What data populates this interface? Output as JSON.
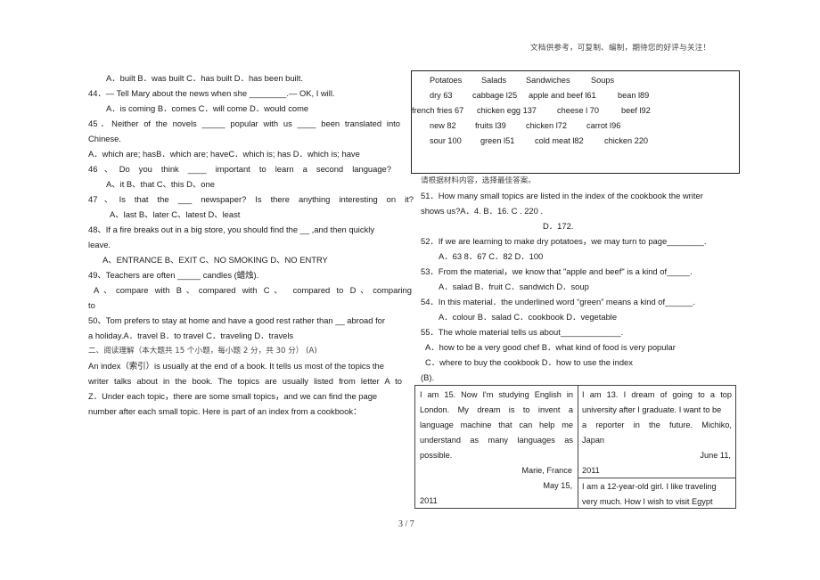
{
  "watermark": "文档供参考，可复制、编制，期待您的好评与关注！",
  "left": {
    "lines": [
      "A．built    B．was built  C．has built          D．has been built.",
      "44．— Tell Mary about the news when she ________.— OK, I will.",
      "A．is coming   B．comes  C．will come                D．would come",
      "45．Neither of the novels _____ popular with us ____ been translated into",
      "Chinese.",
      "A．which are; hasB．which are; haveC．which is; has D．which is; have",
      "46、Do you think ____ important to learn a second language?",
      "A、it          B、that            C、this            D、one",
      "47、Is that the ___ newspaper? Is there anything interesting on it?",
      "A、last     B、later          C、latest          D、least",
      "48、If a fire breaks out in a   big store, you should find the  __ ,and then quickly",
      "leave.",
      "A、ENTRANCE        B、EXIT         C、NO SMOKING          D、NO ENTRY",
      "49、Teachers  are  often  _____  candles (蜡烛).",
      "A、compare with    B、compared   with     C、 compared  to  D、comparing",
      "to",
      "50、Tom prefers to stay at home and have a good rest rather than __ abroad for",
      "a holiday.A．travel      B．to travel   C．traveling           D．travels",
      "二、阅读理解（本大题共 15 个小题，每小题 2 分，共 30 分）     (A)",
      "An index（索引）is usually at the end of a book.  It tells us most of the topics the",
      "writer talks about in the book.  The topics are usually listed from letter A to",
      "Z．Under each topic，there are some small topics，and we can find the page",
      "number after each small topic.  Here is part of an index from a cookbook："
    ]
  },
  "index_box": {
    "rows": [
      [
        "Potatoes",
        "Salads",
        "Sandwiches",
        "Soups"
      ],
      [
        "dry 63",
        "cabbage l25",
        "apple and beef l61",
        "bean l89"
      ],
      [
        "french fries 67",
        "chicken egg 137",
        "cheese l 70",
        "beef l92"
      ],
      [
        "new 82",
        "fruits l39",
        "chicken l72",
        "carrot l96"
      ],
      [
        "sour 100",
        "green l51",
        "cold meat l82",
        "chicken 220"
      ]
    ]
  },
  "right": {
    "instruction": "请根据材料内容，选择最佳答案。",
    "lines": [
      "51．How many small topics are listed in the index of the cookbook the writer",
      "shows us?A．4.       B．16.                                        C      .       220      .",
      "D．172.",
      "52．If we are learning to make dry potatoes，we may turn to page________.",
      "A．63      8．67              C．82                     D．100",
      "53．From the material，we know that \"apple and beef\" is a kind of_____.",
      "A．salad       B．fruit       C．sandwich        D．soup",
      "54．In this material．the underlined word “green” means a kind of______.",
      "A．colour       B．salad      C．cookbook            D．vegetable",
      "55．The whole material tells us about_____________.",
      "A．how to be a very good chef        B．what kind of food is very popular",
      "C．where to buy the cookbook          D．how to use the index",
      "(B)."
    ]
  },
  "letters_table": {
    "left_cell": [
      "I am 15. Now I'm studying English in",
      "London.  My  dream  is  to  invent  a",
      "language machine that can help me",
      "understand  as  many  languages  as",
      "possible.",
      "Marie, France",
      "May       15,",
      "2011"
    ],
    "right_top_cell": [
      "I am 13. I dream of going to a top",
      "university after I graduate. I want to be",
      "a  reporter  in  the  future.     Michiko,",
      "Japan",
      "June        11,",
      "2011"
    ],
    "right_bottom_cell": [
      "I am a 12-year-old girl. I like traveling",
      "very much. How I wish to visit Egypt"
    ]
  },
  "page_number": "3  / 7"
}
